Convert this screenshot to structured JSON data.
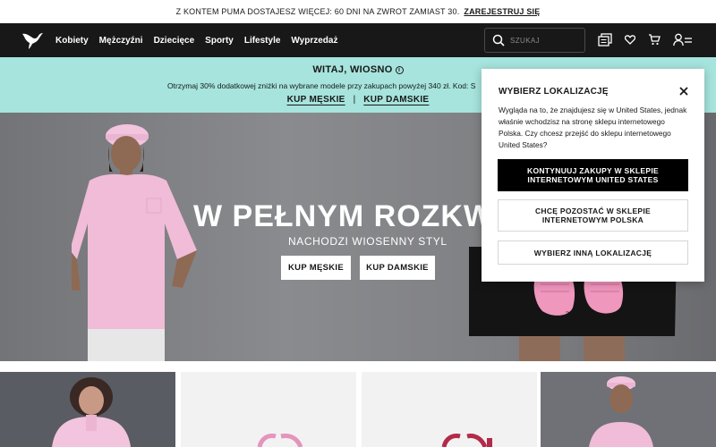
{
  "announcement": {
    "text": "Z KONTEM PUMA DOSTAJESZ WIĘCEJ: 60 DNI NA ZWROT ZAMIAST 30.",
    "link": "ZAREJESTRUJ SIĘ"
  },
  "nav": {
    "items": [
      "Kobiety",
      "Mężczyźni",
      "Dziecięce",
      "Sporty",
      "Lifestyle",
      "Wyprzedaż"
    ],
    "search_placeholder": "SZUKAJ",
    "icons": [
      "search-icon",
      "order-tracking-icon",
      "heart-icon",
      "cart-icon",
      "account-icon"
    ]
  },
  "promo": {
    "title": "WITAJ, WIOSNO",
    "text": "Otrzymaj 30% dodatkowej zniżki na wybrane modele przy zakupach powyżej 340 zł. Kod: S",
    "link_men": "KUP MĘSKIE",
    "separator": "|",
    "link_women": "KUP DAMSKIE"
  },
  "hero": {
    "title": "W PEŁNYM ROZKWIC",
    "subtitle": "NACHODZI WIOSENNY STYL",
    "btn_men": "KUP MĘSKIE",
    "btn_women": "KUP DAMSKIE"
  },
  "modal": {
    "title": "WYBIERZ LOKALIZACJĘ",
    "body": "Wygląda na to, że znajdujesz się w United States, jednak właśnie wchodzisz na stronę sklepu internetowego Polska. Czy chcesz przejść do sklepu internetowego United States?",
    "btn_continue": "KONTYNUUJ ZAKUPY W SKLEPIE INTERNETOWYM UNITED STATES",
    "btn_stay": "CHCĘ POZOSTAĆ W SKLEPIE INTERNETOWYM POLSKA",
    "btn_other": "WYBIERZ INNĄ LOKALIZACJĘ"
  },
  "colors": {
    "nav_bg": "#181818",
    "promo_bg": "#a6e4dd",
    "hero_bg": "#7f8083",
    "shirt_pink": "#f0bcd8"
  }
}
